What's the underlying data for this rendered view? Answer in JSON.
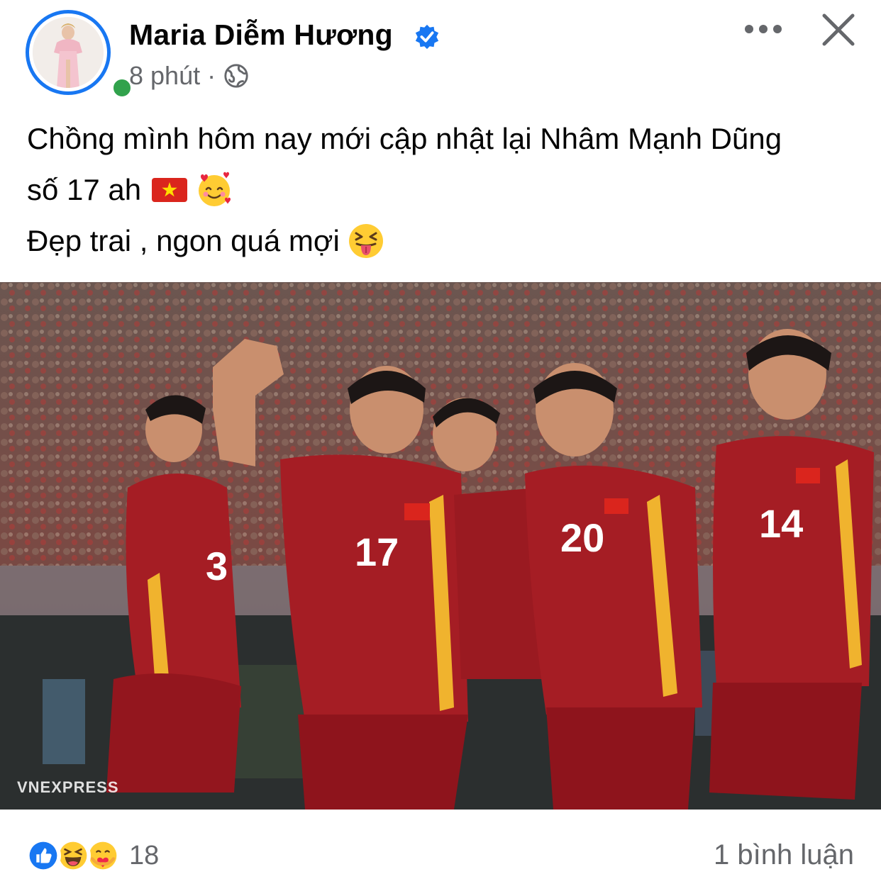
{
  "post": {
    "author_name": "Maria Diễm Hương",
    "timestamp": "8 phút",
    "separator": "·",
    "privacy_icon": "globe-icon",
    "text_lines": [
      "Chồng mình hôm nay mới cập nhật lại Nhâm Mạnh Dũng",
      "số 17 ah",
      "Đẹp trai , ngon quá mợi"
    ],
    "image": {
      "watermark": "VNEXPRESS",
      "jersey_numbers": [
        "3",
        "17",
        "20",
        "14"
      ]
    }
  },
  "footer": {
    "reaction_count": "18",
    "comments": "1 bình luận",
    "reaction_icons": [
      "like-icon",
      "haha-icon",
      "care-icon"
    ]
  },
  "colors": {
    "verified": "#1877f2",
    "online": "#31a24c",
    "secondary_text": "#65676b",
    "jersey": "#a51d24"
  }
}
